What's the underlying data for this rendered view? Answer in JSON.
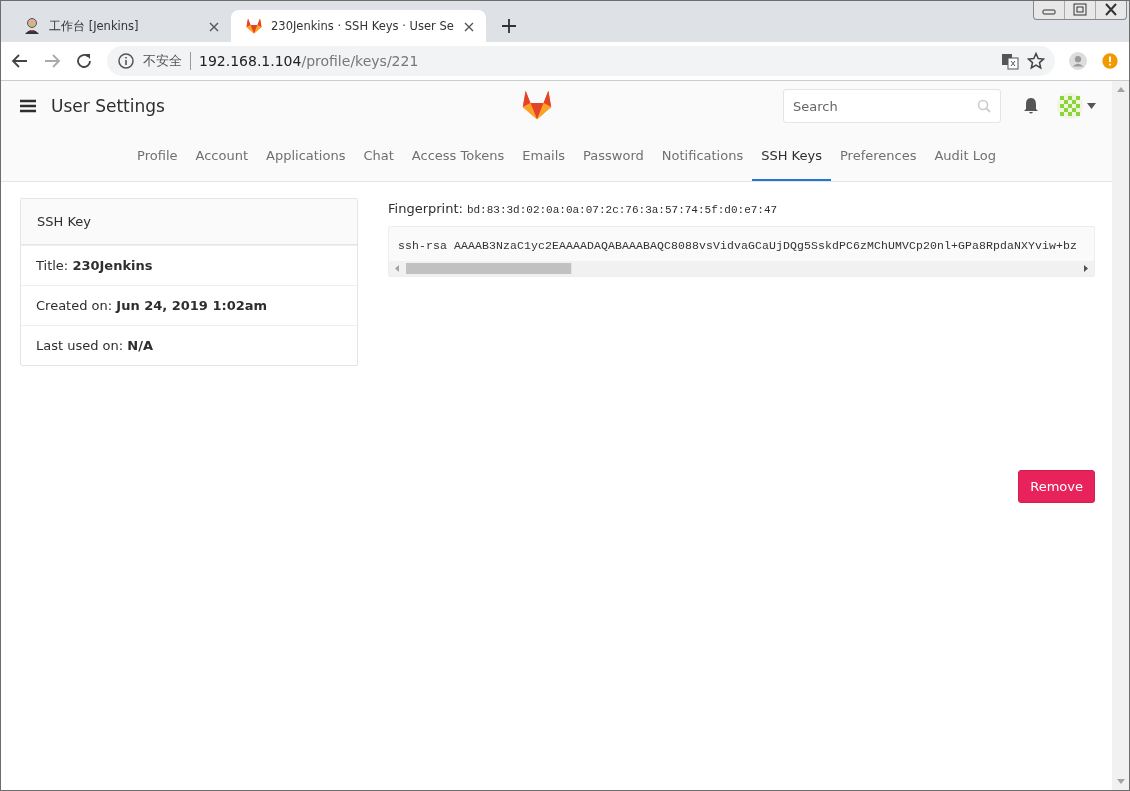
{
  "browser": {
    "tabs": [
      {
        "title": "工作台 [Jenkins]",
        "selected": false,
        "kind": "person"
      },
      {
        "title": "230Jenkins · SSH Keys · User Se",
        "selected": true,
        "kind": "fox"
      }
    ],
    "address": {
      "security_label": "不安全",
      "host": "192.168.1.104",
      "path": "/profile/keys/221"
    }
  },
  "header": {
    "title": "User Settings",
    "search": {
      "placeholder": "Search"
    }
  },
  "nav": [
    {
      "label": "Profile",
      "selected": false
    },
    {
      "label": "Account",
      "selected": false
    },
    {
      "label": "Applications",
      "selected": false
    },
    {
      "label": "Chat",
      "selected": false
    },
    {
      "label": "Access Tokens",
      "selected": false
    },
    {
      "label": "Emails",
      "selected": false
    },
    {
      "label": "Password",
      "selected": false
    },
    {
      "label": "Notifications",
      "selected": false
    },
    {
      "label": "SSH Keys",
      "selected": true
    },
    {
      "label": "Preferences",
      "selected": false
    },
    {
      "label": "Audit Log",
      "selected": false
    }
  ],
  "key_card": {
    "heading": "SSH Key",
    "rows": [
      {
        "label": "Title:",
        "value": "230Jenkins"
      },
      {
        "label": "Created on:",
        "value": "Jun 24, 2019 1:02am"
      },
      {
        "label": "Last used on:",
        "value": "N/A"
      }
    ]
  },
  "fingerprint": {
    "label": "Fingerprint:",
    "value": "bd:83:3d:02:0a:0a:07:2c:76:3a:57:74:5f:d0:e7:47"
  },
  "public_key": "ssh-rsa AAAAB3NzaC1yc2EAAAADAQABAAABAQC8088vsVidvaGCaUjDQg5SskdPC6zMChUMVCp20nl+GPa8RpdaNXYviw+bz",
  "remove_button": "Remove"
}
